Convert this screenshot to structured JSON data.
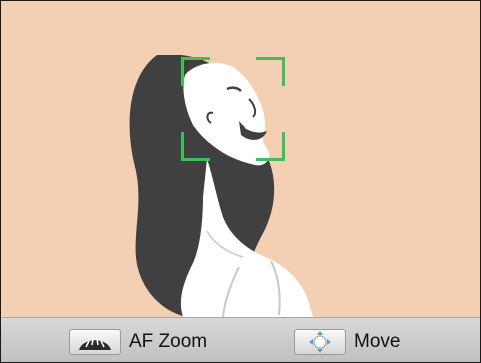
{
  "screen": {
    "background_color": "#f3cfb4",
    "af_frame_color": "#3fbf57"
  },
  "bottom_bar": {
    "af_zoom": {
      "icon": "zoom-dial-icon",
      "label": "AF Zoom"
    },
    "move": {
      "icon": "directional-pad-icon",
      "label": "Move"
    }
  }
}
